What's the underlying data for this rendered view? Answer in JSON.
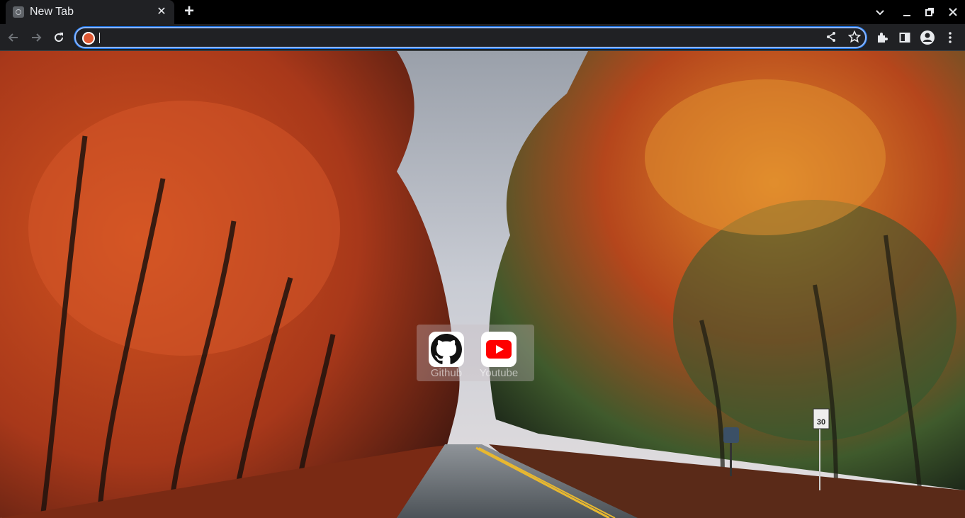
{
  "tab": {
    "title": "New Tab",
    "close_symbol": "✕",
    "favicon": "new-tab-icon"
  },
  "new_tab_symbol": "+",
  "window_controls": [
    "tab-search-icon",
    "minimize-icon",
    "restore-icon",
    "close-icon"
  ],
  "toolbar": {
    "back": "back-arrow-icon",
    "forward": "forward-arrow-icon",
    "reload": "reload-icon",
    "omnibox": {
      "value": "",
      "placeholder": "",
      "search_engine_icon": "duckduckgo-icon"
    },
    "actions": [
      "share-icon",
      "bookmark-star-icon",
      "extensions-icon",
      "side-panel-icon",
      "profile-icon",
      "menu-icon"
    ]
  },
  "shortcuts": [
    {
      "label": "Github",
      "icon": "github-icon"
    },
    {
      "label": "Youtube",
      "icon": "youtube-icon"
    }
  ],
  "background": {
    "description_colors": {
      "sky": "#c9ccd4",
      "foliage_left": "#c2451c",
      "foliage_right": "#d9731f",
      "road": "#6f7479"
    }
  },
  "sign": {
    "speed_limit": "30"
  }
}
